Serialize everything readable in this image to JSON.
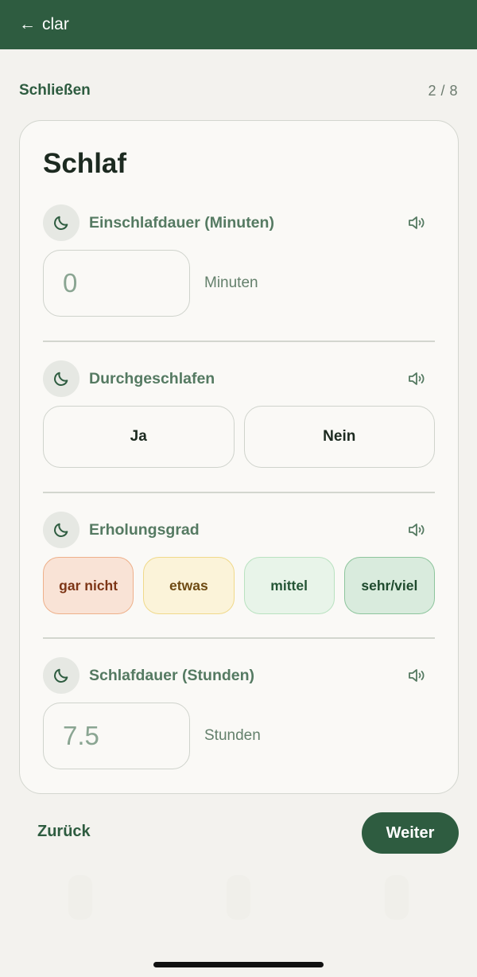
{
  "topbar": {
    "back_arrow": "←",
    "title": "clar"
  },
  "subheader": {
    "close_label": "Schließen",
    "progress": "2 / 8"
  },
  "card": {
    "title": "Schlaf",
    "sections": {
      "sleep_latency": {
        "label": "Einschlafdauer (Minuten)",
        "value": "0",
        "unit": "Minuten"
      },
      "slept_through": {
        "label": "Durchgeschlafen",
        "yes": "Ja",
        "no": "Nein"
      },
      "recovery": {
        "label": "Erholungsgrad",
        "options": [
          "gar nicht",
          "etwas",
          "mittel",
          "sehr/viel"
        ]
      },
      "sleep_duration": {
        "label": "Schlafdauer (Stunden)",
        "value": "7.5",
        "unit": "Stunden"
      }
    }
  },
  "footer": {
    "back_label": "Zurück",
    "next_label": "Weiter"
  },
  "icons": {
    "section": "moon-icon",
    "audio": "speaker-icon",
    "nav": "arrow-left-icon"
  },
  "colors": {
    "brand": "#2e5c40",
    "accent_text": "#557a62",
    "background": "#f3f2ee"
  }
}
